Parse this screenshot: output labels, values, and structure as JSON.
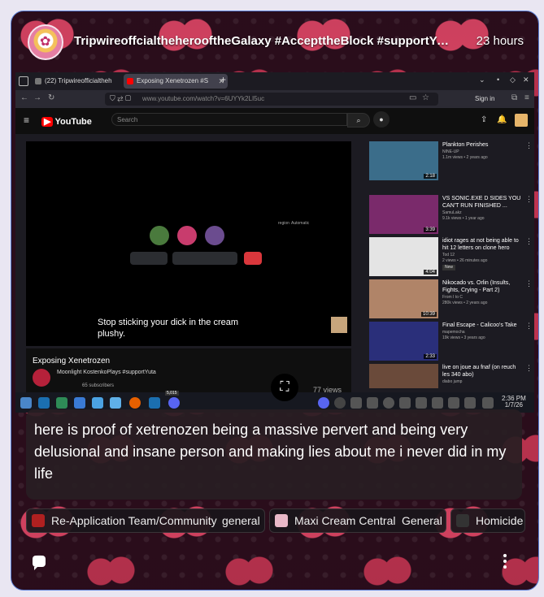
{
  "post": {
    "username": "TripwireoffcialtheherooftheGalaxy #AccepttheBlock #supportYuta...",
    "timestamp": "23 hours",
    "message": "here is proof of xetrenozen being a massive pervert and being very delusional and insane person and making lies about me i never did in my life"
  },
  "browser": {
    "tabs": [
      {
        "label": "(22) Tripwireofficialtheh"
      },
      {
        "label": "Exposing Xenetrozen #S"
      }
    ],
    "url": "www.youtube.com/watch?v=6UYYk2LI5uc",
    "sign_in": "Sign in"
  },
  "youtube": {
    "logo": "YouTube",
    "search_placeholder": "Search",
    "caption": "Stop sticking your dick in the cream plushy.",
    "video_title": "Exposing Xenetrozen",
    "channel": "Moonlight KostenkoPlays #supportYuta",
    "subscribers": "65 subscribers",
    "views": "77 views",
    "call_labels": [
      "region",
      "Automatic"
    ],
    "suggestions": [
      {
        "title": "Plankton Perishes",
        "meta": [
          "NINE-UP",
          "1.1m views • 2 years ago"
        ],
        "duration": "2:18"
      },
      {
        "title": "VS SONIC.EXE D SIDES YOU CAN'T RUN FINISHED ...",
        "meta": [
          "SamuLakz",
          "9.1k views • 1 year ago"
        ],
        "duration": "3:39"
      },
      {
        "title": "idiot rages at not being able to hit 12 letters on clone hero",
        "meta": [
          "Tod 12",
          "2 views • 26 minutes ago",
          "New"
        ],
        "duration": "4:04"
      },
      {
        "title": "Nikocado vs. Orlin (Insults, Fights, Crying - Part 2)",
        "meta": [
          "From I to C",
          "280k views • 2 years ago"
        ],
        "duration": "10:39"
      },
      {
        "title": "Final Escape - Calicoo's Take",
        "meta": [
          "mapemocha",
          "19k views • 3 years ago"
        ],
        "duration": "2:33"
      },
      {
        "title": "live on joue au fnaf (on reuch les 340 abo)",
        "meta": [
          "diabo jump"
        ],
        "duration": ""
      }
    ]
  },
  "taskbar": {
    "time": "2:36 PM",
    "date": "1/7/26",
    "badge": "5,015"
  },
  "channels": [
    {
      "name": "Re-Application Team/Community",
      "sub": "general"
    },
    {
      "name": "Maxi Cream Central",
      "sub": "General"
    },
    {
      "name": "Homicide",
      "sub": ""
    }
  ],
  "icons": {
    "compose": "chat-bubble-icon",
    "more": "vertical-dots-icon",
    "fullscreen": "fullscreen-icon"
  }
}
